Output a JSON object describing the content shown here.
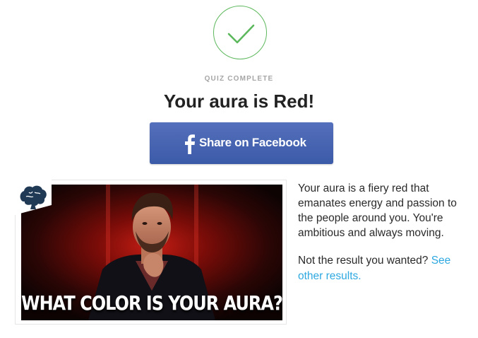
{
  "status": {
    "icon": "check-icon",
    "label": "QUIZ COMPLETE"
  },
  "result": {
    "title": "Your aura is Red!",
    "description": "Your aura is a fiery red that emanates energy and passion to the people around you. You're ambitious and always moving."
  },
  "share": {
    "label": "Share on Facebook",
    "icon": "facebook-icon",
    "color": "#4a66b3"
  },
  "image": {
    "caption": "WHAT COLOR IS YOUR AURA?",
    "badge_icon": "brain-icon"
  },
  "retry": {
    "prompt": "Not the result you wanted?",
    "link_text": "See other results."
  },
  "colors": {
    "success": "#5cb85c",
    "link": "#2ea8e0",
    "muted": "#a6a6a6"
  }
}
